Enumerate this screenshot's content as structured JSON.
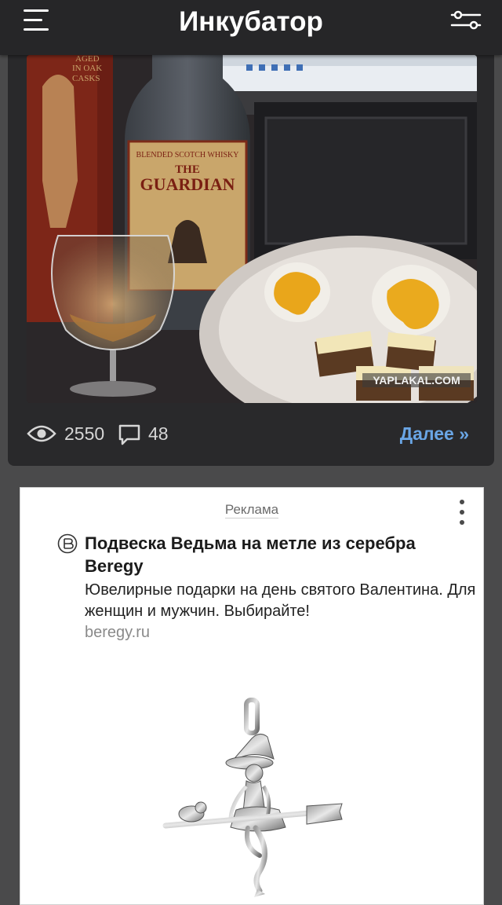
{
  "header": {
    "title": "Инкубатор",
    "menu_icon": "hamburger-menu-icon",
    "filter_icon": "filter-settings-icon"
  },
  "post": {
    "image_watermark": "YAPLAKAL.COM",
    "bottle_label_lines": [
      "BLENDED SCOTCH WHISKY",
      "THE",
      "GUARDIAN"
    ],
    "box_text": [
      "AGED",
      "IN OAK",
      "CASKS"
    ],
    "views": "2550",
    "comments": "48",
    "more_label": "Далее »"
  },
  "ad": {
    "label": "Реклама",
    "title": "Подвеска Ведьма на метле из серебра Beregy",
    "text": "Ювелирные подарки на день святого Валентина. Для женщин и мужчин. Выбирайте!",
    "domain": "beregy.ru"
  },
  "colors": {
    "background": "#4a4a4b",
    "header": "#262628",
    "card": "#29292b",
    "link": "#6aa6e6"
  }
}
